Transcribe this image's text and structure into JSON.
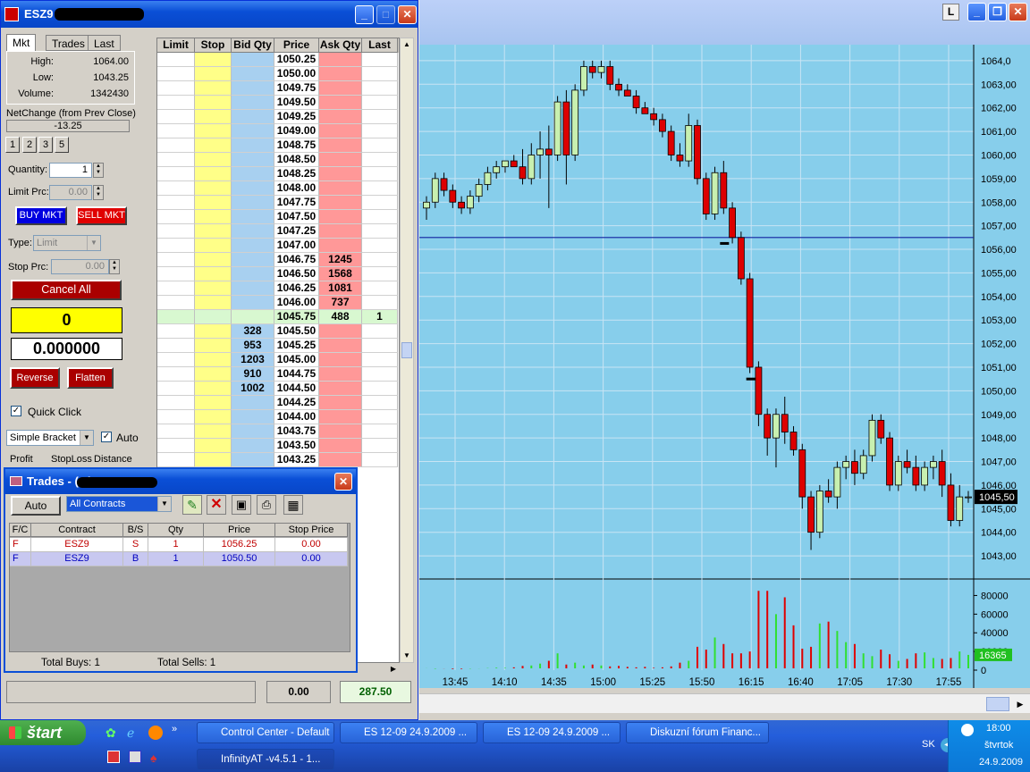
{
  "main_window": {
    "title": "ESZ9 - (1 ) -v4.5.1",
    "tabs": [
      "Mkt",
      "Trades",
      "Last"
    ],
    "market": {
      "high_label": "High:",
      "high": "1064.00",
      "low_label": "Low:",
      "low": "1043.25",
      "volume_label": "Volume:",
      "volume": "1342430"
    },
    "netchange_label": "NetChange (from Prev Close)",
    "netchange_value": "-13.25",
    "quick_qty": [
      "1",
      "2",
      "3",
      "5"
    ],
    "quantity_label": "Quantity:",
    "quantity_value": "1",
    "limit_label": "Limit Prc:",
    "limit_value": "0.00",
    "buy_label": "BUY MKT",
    "sell_label": "SELL MKT",
    "type_label": "Type:",
    "type_value": "Limit",
    "stop_label": "Stop Prc:",
    "stop_value": "0.00",
    "cancel_label": "Cancel All",
    "position": "0",
    "pnl": "0.000000",
    "reverse_label": "Reverse",
    "flatten_label": "Flatten",
    "quick_click_label": "Quick Click",
    "bracket_value": "Simple Bracket",
    "auto_label": "Auto",
    "profit_label": "Profit",
    "stoploss_label": "StopLoss",
    "distance_label": "Distance",
    "footer_left": "0.00",
    "footer_right": "287.50"
  },
  "ladder": {
    "headers": [
      "Limit",
      "Stop",
      "Bid Qty",
      "Price",
      "Ask Qty",
      "Last"
    ],
    "rows": [
      {
        "price": "1050.25",
        "bid": "",
        "ask": "",
        "last": ""
      },
      {
        "price": "1050.00",
        "bid": "",
        "ask": "",
        "last": ""
      },
      {
        "price": "1049.75",
        "bid": "",
        "ask": "",
        "last": ""
      },
      {
        "price": "1049.50",
        "bid": "",
        "ask": "",
        "last": ""
      },
      {
        "price": "1049.25",
        "bid": "",
        "ask": "",
        "last": ""
      },
      {
        "price": "1049.00",
        "bid": "",
        "ask": "",
        "last": ""
      },
      {
        "price": "1048.75",
        "bid": "",
        "ask": "",
        "last": ""
      },
      {
        "price": "1048.50",
        "bid": "",
        "ask": "",
        "last": ""
      },
      {
        "price": "1048.25",
        "bid": "",
        "ask": "",
        "last": ""
      },
      {
        "price": "1048.00",
        "bid": "",
        "ask": "",
        "last": ""
      },
      {
        "price": "1047.75",
        "bid": "",
        "ask": "",
        "last": ""
      },
      {
        "price": "1047.50",
        "bid": "",
        "ask": "",
        "last": ""
      },
      {
        "price": "1047.25",
        "bid": "",
        "ask": "",
        "last": ""
      },
      {
        "price": "1047.00",
        "bid": "",
        "ask": "",
        "last": ""
      },
      {
        "price": "1046.75",
        "bid": "",
        "ask": "1245",
        "last": ""
      },
      {
        "price": "1046.50",
        "bid": "",
        "ask": "1568",
        "last": ""
      },
      {
        "price": "1046.25",
        "bid": "",
        "ask": "1081",
        "last": ""
      },
      {
        "price": "1046.00",
        "bid": "",
        "ask": "737",
        "last": ""
      },
      {
        "price": "1045.75",
        "bid": "",
        "ask": "488",
        "last": "1",
        "current": true
      },
      {
        "price": "1045.50",
        "bid": "328",
        "ask": "",
        "last": ""
      },
      {
        "price": "1045.25",
        "bid": "953",
        "ask": "",
        "last": ""
      },
      {
        "price": "1045.00",
        "bid": "1203",
        "ask": "",
        "last": ""
      },
      {
        "price": "1044.75",
        "bid": "910",
        "ask": "",
        "last": ""
      },
      {
        "price": "1044.50",
        "bid": "1002",
        "ask": "",
        "last": ""
      },
      {
        "price": "1044.25",
        "bid": "",
        "ask": "",
        "last": ""
      },
      {
        "price": "1044.00",
        "bid": "",
        "ask": "",
        "last": ""
      },
      {
        "price": "1043.75",
        "bid": "",
        "ask": "",
        "last": ""
      },
      {
        "price": "1043.50",
        "bid": "",
        "ask": "",
        "last": ""
      },
      {
        "price": "1043.25",
        "bid": "",
        "ask": "",
        "last": ""
      }
    ]
  },
  "trades_window": {
    "title": "Trades - ( 4)",
    "auto_label": "Auto",
    "filter_value": "All Contracts",
    "headers": [
      "F/C",
      "Contract",
      "B/S",
      "Qty",
      "Price",
      "Stop Price"
    ],
    "rows": [
      {
        "fc": "F",
        "contract": "ESZ9",
        "bs": "S",
        "qty": "1",
        "price": "1056.25",
        "stop": "0.00"
      },
      {
        "fc": "F",
        "contract": "ESZ9",
        "bs": "B",
        "qty": "1",
        "price": "1050.50",
        "stop": "0.00"
      }
    ],
    "total_buys": "Total Buys: 1",
    "total_sells": "Total Sells: 1"
  },
  "chart_window": {
    "l_label": "L",
    "price_axis": [
      "1064,0",
      "1063,00",
      "1062,00",
      "1061,00",
      "1060,00",
      "1059,00",
      "1058,00",
      "1057,00",
      "1056,00",
      "1055,00",
      "1054,00",
      "1053,00",
      "1052,00",
      "1051,00",
      "1050,00",
      "1049,00",
      "1048,00",
      "1047,00",
      "1046,00",
      "1045,00",
      "1044,00",
      "1043,00"
    ],
    "last_price": "1045,50",
    "volume_axis": [
      "80000",
      "60000",
      "40000",
      "20000",
      "0"
    ],
    "last_volume": "16365",
    "time_axis": [
      "13:45",
      "14:10",
      "14:35",
      "15:00",
      "15:25",
      "15:50",
      "16:15",
      "16:40",
      "17:05",
      "17:30",
      "17:55"
    ],
    "bull_color": "#c8f0b0",
    "bear_color": "#dd0000",
    "bg_color": "#87ceeb"
  },
  "chart_data": {
    "type": "candlestick",
    "ylabel": "",
    "ylim": [
      1042.7,
      1064.3
    ],
    "hline": 1056.5,
    "candles": [
      [
        1057.75,
        1058.25,
        1057.25,
        1058.0
      ],
      [
        1058.0,
        1059.25,
        1057.75,
        1059.0
      ],
      [
        1059.0,
        1059.25,
        1058.25,
        1058.5
      ],
      [
        1058.5,
        1058.75,
        1057.75,
        1058.0
      ],
      [
        1058.0,
        1058.25,
        1057.5,
        1057.75
      ],
      [
        1057.75,
        1058.5,
        1057.5,
        1058.25
      ],
      [
        1058.25,
        1059.0,
        1058.0,
        1058.75
      ],
      [
        1058.75,
        1059.5,
        1058.5,
        1059.25
      ],
      [
        1059.25,
        1059.75,
        1059.0,
        1059.5
      ],
      [
        1059.5,
        1059.75,
        1059.25,
        1059.75
      ],
      [
        1059.75,
        1060.0,
        1059.5,
        1059.5
      ],
      [
        1059.5,
        1060.25,
        1058.75,
        1059.0
      ],
      [
        1059.0,
        1060.5,
        1058.75,
        1060.0
      ],
      [
        1060.0,
        1061.0,
        1059.0,
        1060.25
      ],
      [
        1060.25,
        1061.25,
        1057.75,
        1060.0
      ],
      [
        1060.0,
        1062.5,
        1059.75,
        1062.25
      ],
      [
        1062.25,
        1062.75,
        1058.75,
        1060.0
      ],
      [
        1060.0,
        1063.0,
        1059.75,
        1062.75
      ],
      [
        1062.75,
        1064.0,
        1062.5,
        1063.75
      ],
      [
        1063.75,
        1064.0,
        1063.25,
        1063.5
      ],
      [
        1063.5,
        1064.0,
        1063.25,
        1063.75
      ],
      [
        1063.75,
        1064.0,
        1062.75,
        1063.0
      ],
      [
        1063.0,
        1063.25,
        1062.5,
        1062.75
      ],
      [
        1062.75,
        1063.0,
        1062.5,
        1062.5
      ],
      [
        1062.5,
        1062.75,
        1061.75,
        1062.0
      ],
      [
        1062.0,
        1062.25,
        1061.75,
        1061.75
      ],
      [
        1061.75,
        1062.0,
        1061.25,
        1061.5
      ],
      [
        1061.5,
        1061.75,
        1060.75,
        1061.0
      ],
      [
        1061.0,
        1061.25,
        1059.75,
        1060.0
      ],
      [
        1060.0,
        1060.5,
        1059.5,
        1059.75
      ],
      [
        1059.75,
        1061.75,
        1059.5,
        1061.25
      ],
      [
        1061.25,
        1061.5,
        1058.75,
        1059.0
      ],
      [
        1059.0,
        1059.25,
        1057.25,
        1057.5
      ],
      [
        1057.5,
        1059.5,
        1057.25,
        1059.25
      ],
      [
        1059.25,
        1059.75,
        1057.5,
        1057.75
      ],
      [
        1057.75,
        1058.0,
        1056.25,
        1056.5
      ],
      [
        1056.5,
        1056.75,
        1054.5,
        1054.75
      ],
      [
        1054.75,
        1055.0,
        1050.75,
        1051.0
      ],
      [
        1051.0,
        1051.25,
        1048.5,
        1049.0
      ],
      [
        1049.0,
        1049.25,
        1047.25,
        1048.0
      ],
      [
        1048.0,
        1049.25,
        1046.75,
        1049.0
      ],
      [
        1049.0,
        1049.75,
        1047.75,
        1048.25
      ],
      [
        1048.25,
        1048.5,
        1047.25,
        1047.5
      ],
      [
        1047.5,
        1047.75,
        1045.0,
        1045.5
      ],
      [
        1045.5,
        1045.75,
        1043.25,
        1044.0
      ],
      [
        1044.0,
        1046.0,
        1043.75,
        1045.75
      ],
      [
        1045.75,
        1046.25,
        1045.25,
        1045.5
      ],
      [
        1045.5,
        1047.0,
        1045.0,
        1046.75
      ],
      [
        1046.75,
        1047.25,
        1046.25,
        1047.0
      ],
      [
        1047.0,
        1047.5,
        1046.0,
        1046.5
      ],
      [
        1046.5,
        1047.5,
        1046.25,
        1047.25
      ],
      [
        1047.25,
        1049.0,
        1047.0,
        1048.75
      ],
      [
        1048.75,
        1049.0,
        1047.75,
        1048.0
      ],
      [
        1048.0,
        1048.25,
        1045.75,
        1046.0
      ],
      [
        1046.0,
        1047.25,
        1045.75,
        1047.0
      ],
      [
        1047.0,
        1047.5,
        1046.5,
        1046.75
      ],
      [
        1046.75,
        1047.25,
        1045.75,
        1046.0
      ],
      [
        1046.0,
        1047.0,
        1045.75,
        1046.75
      ],
      [
        1046.75,
        1047.25,
        1046.25,
        1047.0
      ],
      [
        1047.0,
        1047.5,
        1045.5,
        1046.0
      ],
      [
        1046.0,
        1046.5,
        1044.25,
        1044.5
      ],
      [
        1044.5,
        1046.0,
        1044.25,
        1045.5
      ],
      [
        1045.5,
        1045.75,
        1045.25,
        1045.5
      ]
    ],
    "volume": [
      2000,
      1500,
      1800,
      1200,
      1300,
      1600,
      1800,
      2200,
      2600,
      2400,
      3000,
      4500,
      5000,
      7000,
      10000,
      18000,
      6000,
      8000,
      5000,
      6000,
      5000,
      4000,
      4500,
      3500,
      3000,
      3500,
      2500,
      3000,
      4000,
      8000,
      10000,
      25000,
      22000,
      35000,
      28000,
      18000,
      18000,
      20000,
      85000,
      85000,
      60000,
      78000,
      48000,
      23000,
      25000,
      50000,
      52000,
      42000,
      30000,
      28000,
      18000,
      15000,
      22000,
      17000,
      10000,
      12000,
      18000,
      19000,
      13000,
      12000,
      13000,
      20000,
      16365
    ]
  },
  "taskbar": {
    "start_label": "štart",
    "tasks": [
      "Control Center - Default",
      "ES 12-09  24.9.2009 ...",
      "ES 12-09  24.9.2009 ...",
      "Diskuzní fórum Financ...",
      "InfinityAT -v4.5.1 - 1..."
    ],
    "lang": "SK",
    "time": "18:00",
    "day": "štvrtok",
    "date": "24.9.2009"
  }
}
